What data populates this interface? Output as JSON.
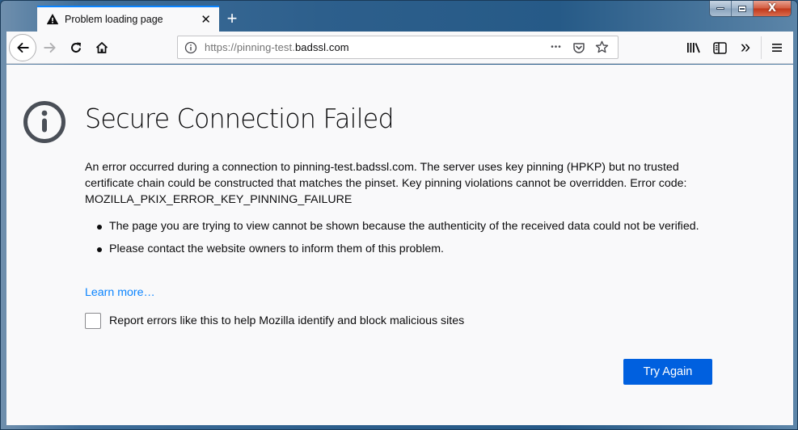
{
  "window": {
    "controls": {
      "minimize_icon": "minimize-icon",
      "maximize_icon": "maximize-icon",
      "close_icon": "close-icon",
      "close_glyph": "X"
    }
  },
  "tabs": [
    {
      "title": "Problem loading page",
      "icon": "warning-icon",
      "active": true,
      "close_glyph": "✕"
    }
  ],
  "new_tab_glyph": "+",
  "toolbar": {
    "back_icon": "back-arrow-icon",
    "forward_icon": "forward-arrow-icon",
    "reload_icon": "reload-icon",
    "home_icon": "home-icon",
    "url": {
      "prefix": "https://pinning-test.",
      "domain": "badssl.com"
    },
    "url_actions": [
      "page-actions-icon",
      "pocket-icon",
      "bookmark-star-icon"
    ],
    "page_actions_glyph": "•••",
    "right_tools": [
      "library-icon",
      "sidebar-icon",
      "overflow-icon",
      "menu-icon"
    ],
    "overflow_glyph": "»"
  },
  "error_page": {
    "icon": "info-icon",
    "title": "Secure Connection Failed",
    "description": "An error occurred during a connection to pinning-test.badssl.com. The server uses key pinning (HPKP) but no trusted certificate chain could be constructed that matches the pinset. Key pinning violations cannot be overridden. Error code: MOZILLA_PKIX_ERROR_KEY_PINNING_FAILURE",
    "bullets": [
      "The page you are trying to view cannot be shown because the authenticity of the received data could not be verified.",
      "Please contact the website owners to inform them of this problem."
    ],
    "learn_more": "Learn more…",
    "report_checkbox": {
      "label": "Report errors like this to help Mozilla identify and block malicious sites",
      "checked": false
    },
    "try_again": "Try Again"
  },
  "colors": {
    "accent_blue": "#0a84ff",
    "button_blue": "#0060df",
    "page_bg": "#f9f9fa",
    "icon_gray": "#4a4f57"
  }
}
